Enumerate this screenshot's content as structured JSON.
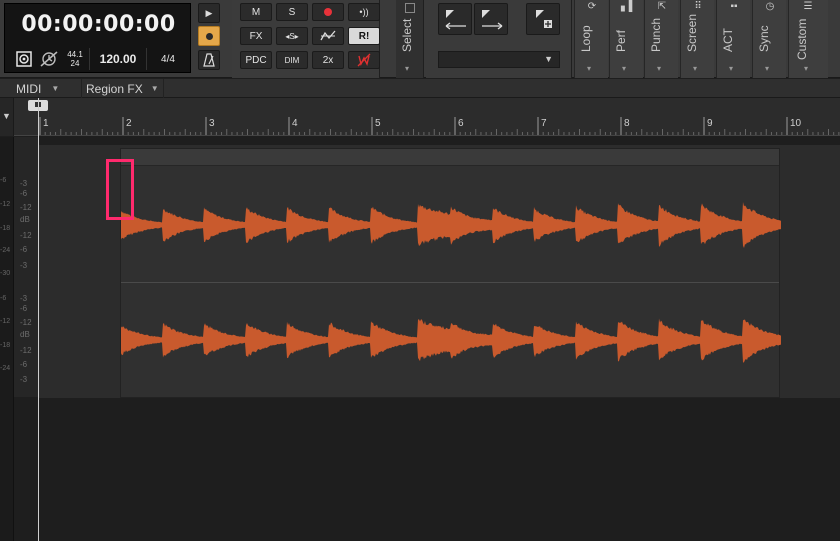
{
  "control_bar": {
    "time": "00:00:00:00",
    "sample_rate": "44.1",
    "bit_depth": "24",
    "tempo": "120.00",
    "meter": "4/4",
    "mix_buttons": {
      "mute": "M",
      "solo": "S",
      "fx": "FX",
      "pdc": "PDC",
      "dim": "DIM",
      "double_speed": "2x",
      "read": "R!"
    },
    "tabs": [
      {
        "label": "Select",
        "icon": "select-icon"
      },
      {
        "label": "Loop",
        "icon": "loop-icon"
      },
      {
        "label": "Perf",
        "icon": "performance-icon"
      },
      {
        "label": "Punch",
        "icon": "punch-icon"
      },
      {
        "label": "Screen",
        "icon": "screenset-icon"
      },
      {
        "label": "ACT",
        "icon": "act-icon"
      },
      {
        "label": "Sync",
        "icon": "sync-clock-icon"
      },
      {
        "label": "Custom",
        "icon": "custom-icon"
      }
    ],
    "snap_value": ""
  },
  "menu": {
    "midi": "MIDI",
    "region_fx": "Region FX"
  },
  "ruler": {
    "bars": [
      "1",
      "2",
      "3",
      "4",
      "5",
      "6",
      "7",
      "8",
      "9",
      "10"
    ]
  },
  "meter_scale": {
    "left": [
      "-6",
      "-12",
      "-18",
      "-24",
      "-30",
      "-6",
      "-12",
      "-18",
      "-24"
    ],
    "inner": [
      "-3",
      "-6",
      "-12",
      "dB",
      "-12",
      "-6",
      "-3",
      "-3",
      "-6",
      "-12",
      "dB",
      "-12",
      "-6",
      "-3"
    ]
  },
  "colors": {
    "waveform": "#c95a2d",
    "record_mode": "#e5a84a",
    "record_dot": "#e8323a",
    "highlight": "#ff2a6d"
  }
}
